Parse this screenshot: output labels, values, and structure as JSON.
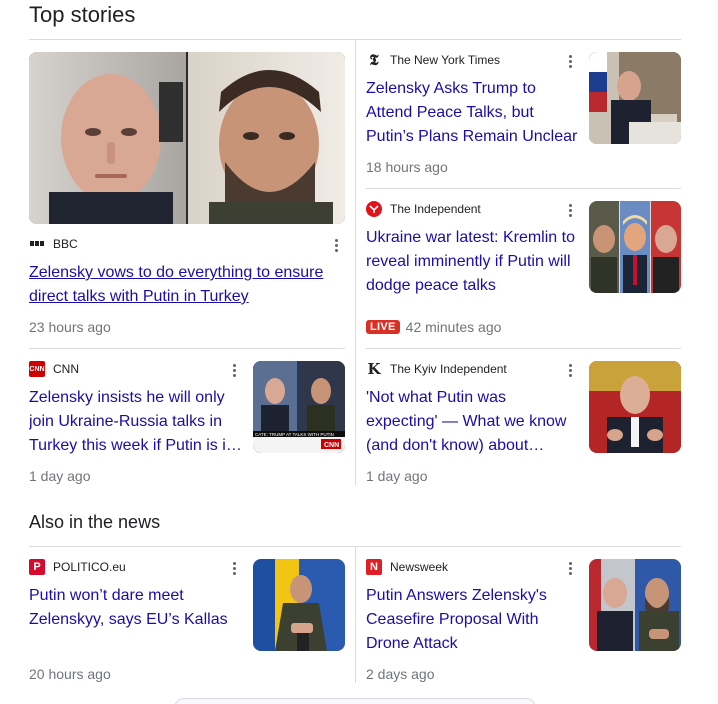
{
  "sections": {
    "top_stories": "Top stories",
    "also_in_news": "Also in the news"
  },
  "stories": {
    "bbc": {
      "source": "BBC",
      "headline": "Zelensky vows to do everything to ensure direct talks with Putin in Turkey",
      "time": "23 hours ago",
      "icon": "bbc-logo-icon",
      "image": "putin-zelensky-portraits"
    },
    "nyt": {
      "source": "The New York Times",
      "headline": "Zelensky Asks Trump to Attend Peace Talks, but Putin’s Plans Remain Unclear",
      "time": "18 hours ago",
      "icon": "nyt-logo-icon",
      "image": "putin-at-desk"
    },
    "independent": {
      "source": "The Independent",
      "headline": "Ukraine war latest: Kremlin to reveal imminently if Putin will dodge peace talks",
      "live": "LIVE",
      "time": "42 minutes ago",
      "icon": "independent-logo-icon",
      "image": "zelensky-trump-putin-collage"
    },
    "cnn": {
      "source": "CNN",
      "headline": "Zelensky insists he will only join Ukraine-Russia talks in Turkey this week if Putin is in attendance",
      "time": "1 day ago",
      "icon": "cnn-logo-icon",
      "image": "cnn-broadcast-still",
      "thumb_caption": "CATE: TRUMP AT TALKS WITH PUTIN"
    },
    "kyiv": {
      "source": "The Kyiv Independent",
      "headline": "'Not what Putin was expecting' — What we know (and don't know) about upcoming talks",
      "time": "1 day ago",
      "icon": "kyiv-independent-logo-icon",
      "image": "putin-speaking"
    },
    "politico": {
      "source": "POLITICO.eu",
      "headline": "Putin won’t dare meet Zelenskyy, says EU’s Kallas",
      "time": "20 hours ago",
      "icon": "politico-logo-icon",
      "image": "zelensky-at-podium"
    },
    "newsweek": {
      "source": "Newsweek",
      "headline": "Putin Answers Zelensky's Ceasefire Proposal With Drone Attack",
      "time": "2 days ago",
      "icon": "newsweek-logo-icon",
      "image": "putin-zelensky-split"
    }
  },
  "colors": {
    "link": "#1a0dab",
    "meta": "#70757a",
    "divider": "#dadce0",
    "live_badge": "#d93025"
  }
}
